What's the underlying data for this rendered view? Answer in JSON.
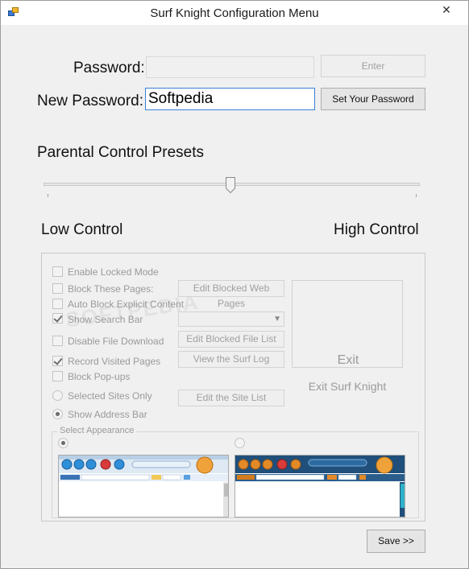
{
  "window": {
    "title": "Surf Knight Configuration Menu",
    "close_glyph": "✕"
  },
  "password": {
    "label": "Password:",
    "value": "",
    "enter_label": "Enter"
  },
  "new_password": {
    "label": "New Password:",
    "value": "Softpedia",
    "set_label": "Set Your Password"
  },
  "presets": {
    "label": "Parental Control Presets",
    "slider_level_fraction": 0.5,
    "low_label": "Low Control",
    "high_label": "High Control"
  },
  "options": {
    "enable_locked_mode": {
      "label": "Enable Locked Mode",
      "checked": false
    },
    "block_these_pages": {
      "label": "Block These Pages:",
      "checked": false
    },
    "auto_block_explicit": {
      "label": "Auto Block Explicit Content",
      "checked": false
    },
    "show_search_bar": {
      "label": "Show Search Bar",
      "checked": true
    },
    "disable_file_download": {
      "label": "Disable File Download",
      "checked": false
    },
    "record_visited_pages": {
      "label": "Record Visited Pages",
      "checked": true
    },
    "block_popups": {
      "label": "Block Pop-ups",
      "checked": false
    },
    "selected_sites_only": {
      "label": "Selected Sites Only",
      "checked": false
    },
    "show_address_bar": {
      "label": "Show Address Bar",
      "checked": true
    }
  },
  "buttons": {
    "edit_blocked_web_pages": "Edit Blocked Web Pages",
    "edit_blocked_file_list": "Edit Blocked File List",
    "view_surf_log": "View the Surf Log",
    "edit_site_list": "Edit the Site List",
    "exit": "Exit",
    "exit_surf_knight": "Exit Surf Knight",
    "save": "Save >>"
  },
  "appearance": {
    "title": "Select Appearance",
    "selected": "light"
  },
  "preview": {
    "address_tag": "ADDRESS",
    "search_engine": "Google"
  },
  "watermark": "SOFTPEDIA",
  "colors": {
    "focus_border": "#3c7fd6",
    "disabled_text": "#9a9a9a",
    "light_toolbar": "#2f7bbf",
    "dark_toolbar": "#1f4f7a"
  }
}
